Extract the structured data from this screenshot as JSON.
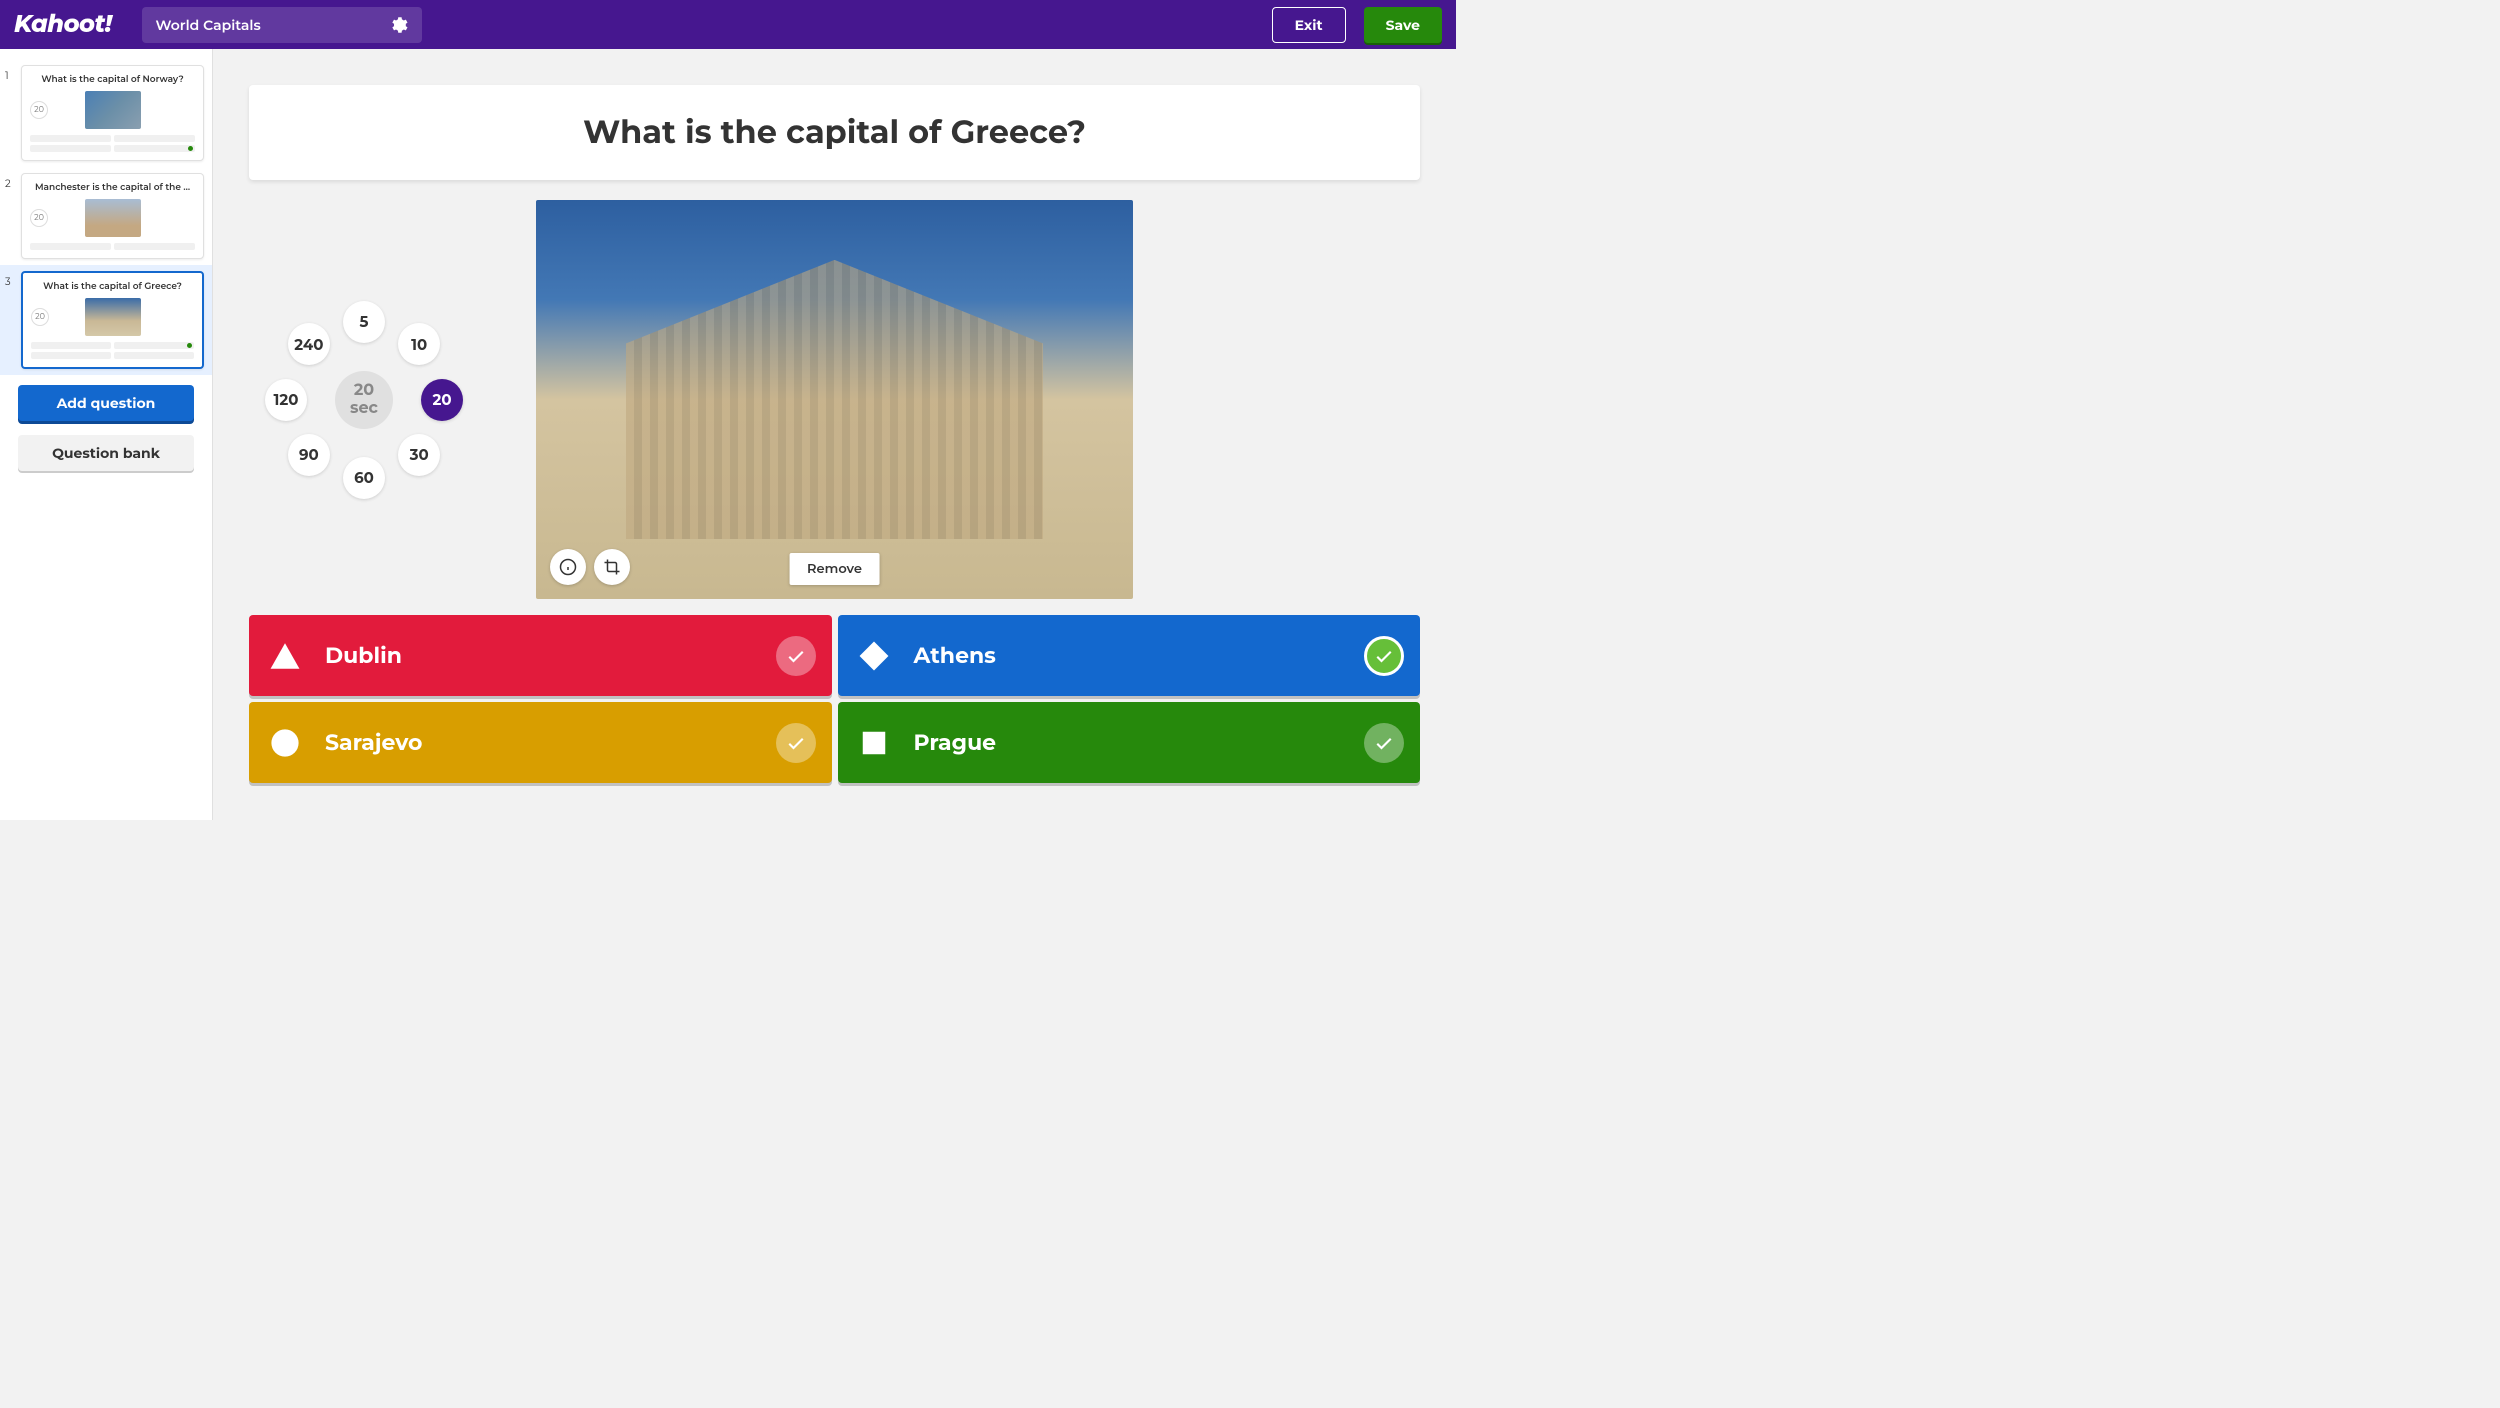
{
  "header": {
    "logo": "Kahoot!",
    "quiz_title": "World Capitals",
    "exit_label": "Exit",
    "save_label": "Save"
  },
  "sidebar": {
    "add_question_label": "Add question",
    "question_bank_label": "Question bank",
    "slides": [
      {
        "num": "1",
        "title": "What is the capital of Norway?",
        "time": "20",
        "correct_index": 3
      },
      {
        "num": "2",
        "title": "Manchester is the capital of the ...",
        "time": "20",
        "correct_index": 2,
        "answer_count": 2
      },
      {
        "num": "3",
        "title": "What is the capital of Greece?",
        "time": "20",
        "correct_index": 1,
        "selected": true
      }
    ]
  },
  "question": {
    "text": "What is the capital of Greece?",
    "image_remove_label": "Remove"
  },
  "timer": {
    "center_value": "20",
    "center_unit": "sec",
    "options": [
      "5",
      "10",
      "20",
      "30",
      "60",
      "90",
      "120",
      "240"
    ],
    "selected": "20"
  },
  "answers": [
    {
      "text": "Dublin",
      "color": "red",
      "shape": "triangle",
      "correct": false
    },
    {
      "text": "Athens",
      "color": "blue",
      "shape": "diamond",
      "correct": true
    },
    {
      "text": "Sarajevo",
      "color": "yellow",
      "shape": "circle",
      "correct": false
    },
    {
      "text": "Prague",
      "color": "green",
      "shape": "square",
      "correct": false
    }
  ]
}
